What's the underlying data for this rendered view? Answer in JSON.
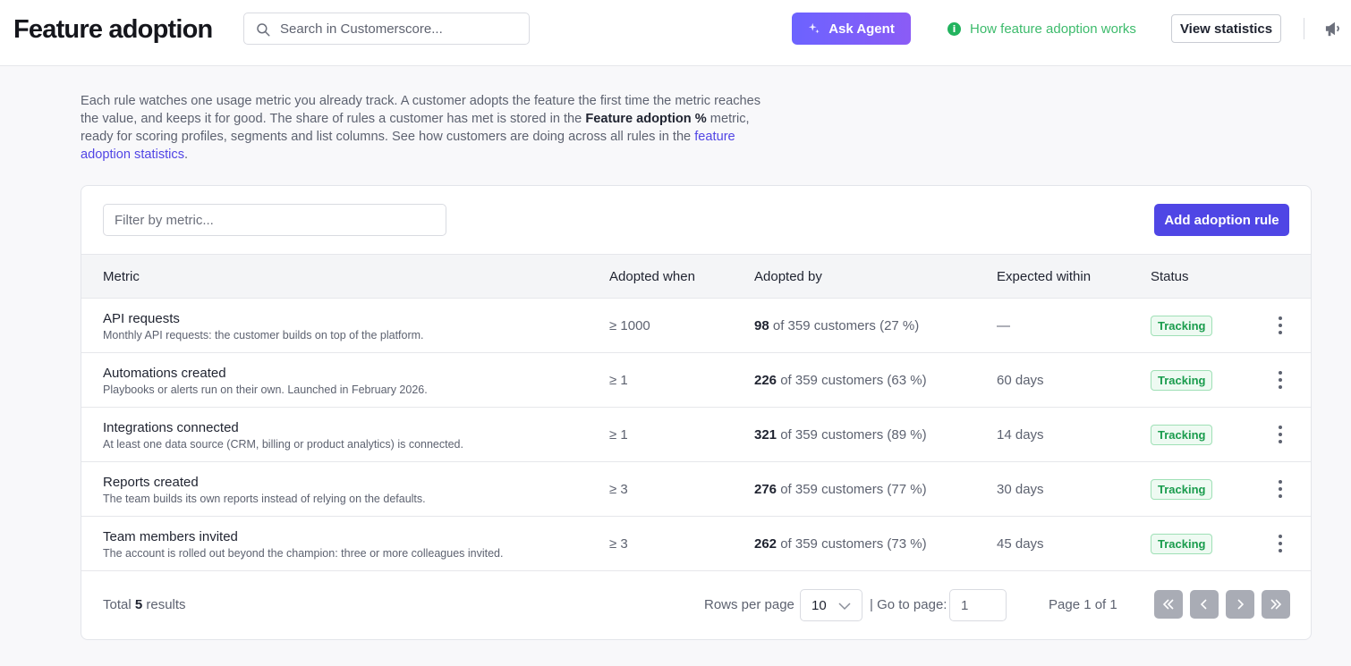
{
  "header": {
    "title": "Feature adoption",
    "search_placeholder": "Search in Customerscore...",
    "ask_agent_label": "Ask Agent",
    "how_link_label": "How feature adoption works",
    "view_stats_label": "View statistics"
  },
  "intro": {
    "part1": "Each rule watches one usage metric you already track. A customer adopts the feature the first time the metric reaches the value, and keeps it for good. The share of rules a customer has met is stored in the ",
    "bold": "Feature adoption %",
    "part2": " metric, ready for scoring profiles, segments and list columns. See how customers are doing across all rules in the ",
    "link": "feature adoption statistics",
    "end": "."
  },
  "toolbar": {
    "filter_placeholder": "Filter by metric...",
    "add_rule_label": "Add adoption rule"
  },
  "table": {
    "columns": [
      "Metric",
      "Adopted when",
      "Adopted by",
      "Expected within",
      "Status"
    ],
    "rows": [
      {
        "name": "API requests",
        "description": "Monthly API requests: the customer builds on top of the platform.",
        "threshold": "≥ 1000",
        "adopted_count": "98",
        "adopted_rest": " of 359 customers (27 %)",
        "expected": "—",
        "status": "Tracking"
      },
      {
        "name": "Automations created",
        "description": "Playbooks or alerts run on their own. Launched in February 2026.",
        "threshold": "≥ 1",
        "adopted_count": "226",
        "adopted_rest": " of 359 customers (63 %)",
        "expected": "60 days",
        "status": "Tracking"
      },
      {
        "name": "Integrations connected",
        "description": "At least one data source (CRM, billing or product analytics) is connected.",
        "threshold": "≥ 1",
        "adopted_count": "321",
        "adopted_rest": " of 359 customers (89 %)",
        "expected": "14 days",
        "status": "Tracking"
      },
      {
        "name": "Reports created",
        "description": "The team builds its own reports instead of relying on the defaults.",
        "threshold": "≥ 3",
        "adopted_count": "276",
        "adopted_rest": " of 359 customers (77 %)",
        "expected": "30 days",
        "status": "Tracking"
      },
      {
        "name": "Team members invited",
        "description": "The account is rolled out beyond the champion: three or more colleagues invited.",
        "threshold": "≥ 3",
        "adopted_count": "262",
        "adopted_rest": " of 359 customers (73 %)",
        "expected": "45 days",
        "status": "Tracking"
      }
    ]
  },
  "footer": {
    "total_prefix": "Total ",
    "total_count": "5",
    "total_suffix": " results",
    "rows_per_page_label": "Rows per page",
    "rows_per_page_value": "10",
    "goto_label": "| Go to page:",
    "goto_value": "1",
    "page_of": "Page 1 of 1"
  },
  "colors": {
    "accent": "#4f46e5",
    "agent_gradient_start": "#6c63ff",
    "agent_gradient_end": "#8b5cf6",
    "success": "#22b35e",
    "badge_text": "#1a9c4d"
  },
  "icons": {
    "search": "search-icon",
    "sparkle": "sparkle-icon",
    "info": "info-icon",
    "megaphone": "megaphone-icon",
    "kebab": "kebab-menu-icon",
    "chevron_down": "chevron-down-icon",
    "first_page": "double-chevron-left-icon",
    "prev_page": "chevron-left-icon",
    "next_page": "chevron-right-icon",
    "last_page": "double-chevron-right-icon"
  }
}
